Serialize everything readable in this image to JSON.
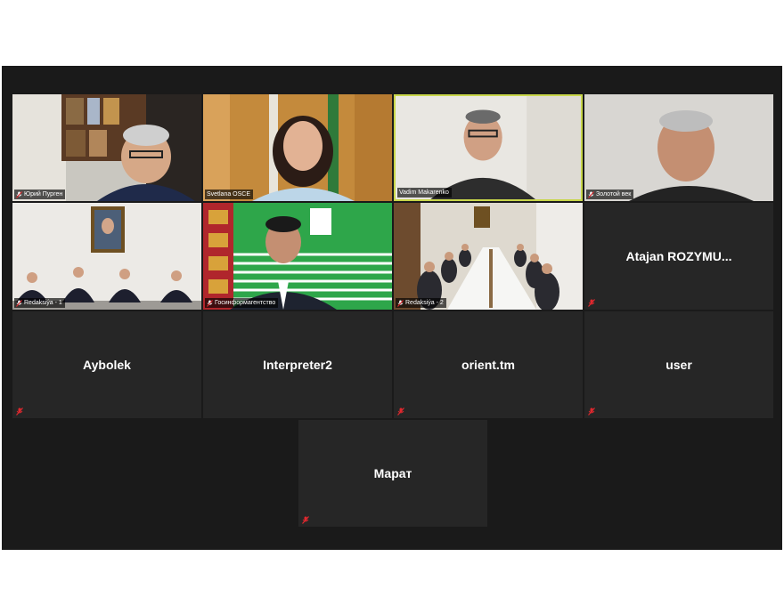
{
  "meeting": {
    "participants": [
      {
        "name": "Юрий Пурген",
        "video": true
      },
      {
        "name": "Svetlana OSCE",
        "video": true
      },
      {
        "name": "Vadim Makarenko",
        "video": true,
        "active_speaker": true
      },
      {
        "name": "Золотой век",
        "video": true
      },
      {
        "name": "Redaksiýa - 1",
        "video": true
      },
      {
        "name": "Госинформагентство",
        "video": true
      },
      {
        "name": "Redaksiýa - 2",
        "video": true
      },
      {
        "name": "Atajan  ROZYMU...",
        "video": false
      },
      {
        "name": "Aybolek",
        "video": false
      },
      {
        "name": "Interpreter2",
        "video": false
      },
      {
        "name": "orient.tm",
        "video": false
      },
      {
        "name": "user",
        "video": false
      },
      {
        "name": "Марат",
        "video": false
      }
    ]
  },
  "colors": {
    "window_bg": "#1a1a1a",
    "tile_bg": "#262626",
    "active_speaker_border": "#c8d64a",
    "muted_icon": "#e0282e"
  },
  "icons": {
    "muted_mic": "mic-muted-icon"
  }
}
